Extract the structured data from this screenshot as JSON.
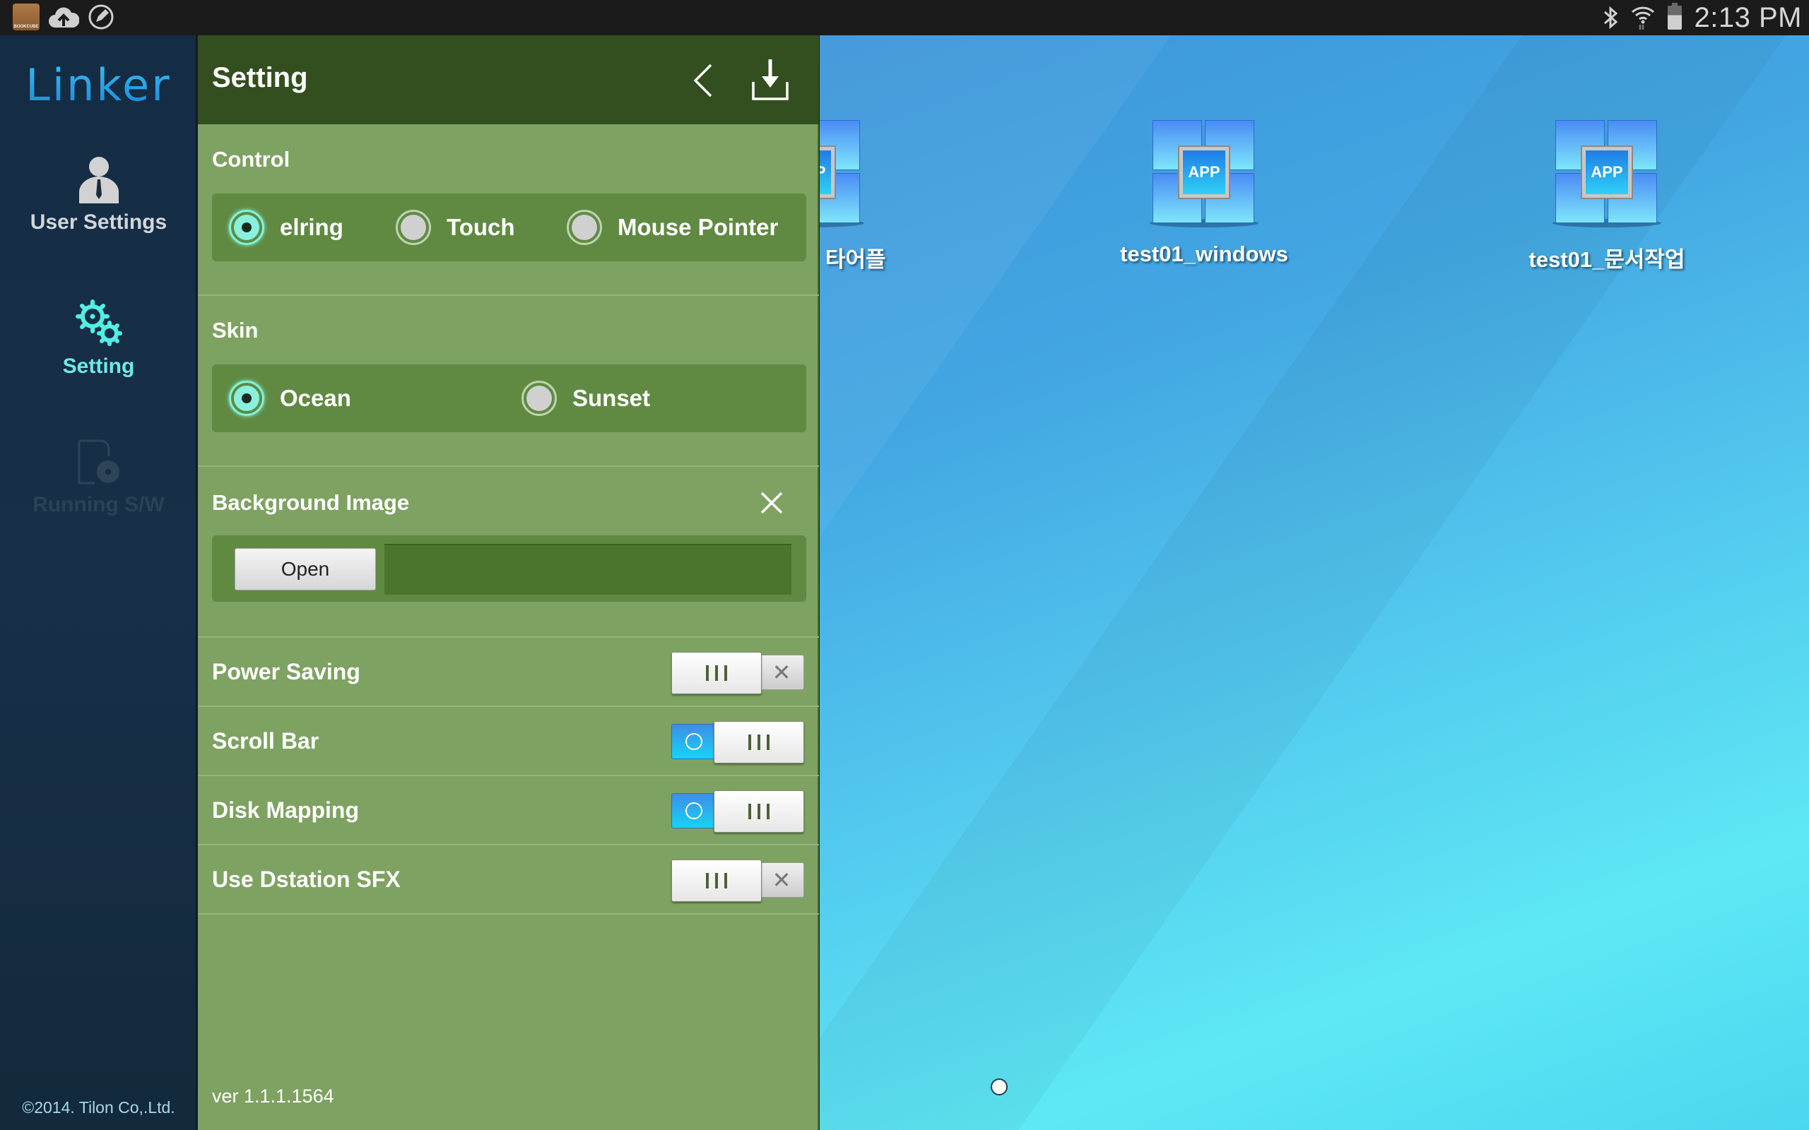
{
  "status_bar": {
    "left_icons": [
      "bookcube-app-icon",
      "cloud-upload-icon",
      "edit-circle-icon"
    ],
    "bookcube_label": "BOOKCUBE",
    "right_icons": [
      "bluetooth-icon",
      "wifi-icon",
      "battery-icon"
    ],
    "time": "2:13 PM"
  },
  "sidebar": {
    "logo": "Linker",
    "items": [
      {
        "label": "User Settings",
        "icon": "user-icon",
        "state": "normal"
      },
      {
        "label": "Setting",
        "icon": "gears-icon",
        "state": "active"
      },
      {
        "label": "Running S/W",
        "icon": "running-software-icon",
        "state": "disabled"
      }
    ],
    "copyright": "©2014. Tilon Co,.Ltd."
  },
  "panel": {
    "title": "Setting",
    "header_icons": [
      "back-chevron-icon",
      "download-save-icon"
    ],
    "control": {
      "label": "Control",
      "options": [
        "elring",
        "Touch",
        "Mouse Pointer"
      ],
      "selected": "elring"
    },
    "skin": {
      "label": "Skin",
      "options": [
        "Ocean",
        "Sunset"
      ],
      "selected": "Ocean"
    },
    "background_image": {
      "label": "Background Image",
      "open_button": "Open",
      "path_value": ""
    },
    "toggles": [
      {
        "label": "Power Saving",
        "on": false
      },
      {
        "label": "Scroll Bar",
        "on": true
      },
      {
        "label": "Disk Mapping",
        "on": true
      },
      {
        "label": "Use Dstation SFX",
        "on": false
      }
    ],
    "version": "ver 1.1.1.1564"
  },
  "desktop": {
    "icons": [
      {
        "label": "타어플",
        "badge": "APP"
      },
      {
        "label": "test01_windows",
        "badge": "APP"
      },
      {
        "label": "test01_문서작업",
        "badge": "APP"
      }
    ],
    "page_indicator": {
      "current": 1,
      "total": 1
    }
  },
  "colors": {
    "sidebar_bg": "#163048",
    "accent_active": "#6fe9e6",
    "panel_header": "#334f1f",
    "panel_bg": "#7ea262",
    "group_box": "#608a42",
    "toggle_on": "#16d3f5"
  }
}
